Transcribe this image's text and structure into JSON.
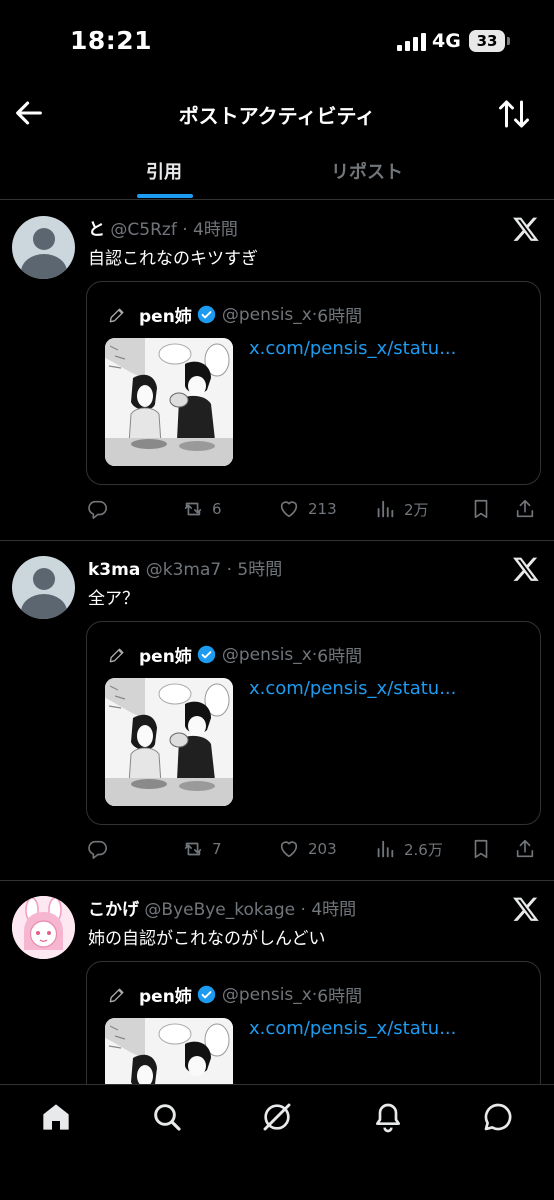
{
  "status_bar": {
    "time": "18:21",
    "network": "4G",
    "battery": "33"
  },
  "header": {
    "title": "ポストアクティビティ",
    "back_icon": "arrow-left-icon",
    "sort_icon": "sort-arrows-icon"
  },
  "tabs": [
    {
      "label": "引用",
      "active": true
    },
    {
      "label": "リポスト",
      "active": false
    }
  ],
  "posts": [
    {
      "name": "と",
      "handle": "@C5Rzf",
      "time": "4時間",
      "text": "自認これなのキツすぎ",
      "quote": {
        "name": "pen姉",
        "handle": "@pensis_x",
        "time": "6時間",
        "link": "x.com/pensis_x/statu..."
      },
      "stats": {
        "retweets": "6",
        "likes": "213",
        "views": "2万"
      }
    },
    {
      "name": "k3ma",
      "handle": "@k3ma7",
      "time": "5時間",
      "text": "全ア？",
      "quote": {
        "name": "pen姉",
        "handle": "@pensis_x",
        "time": "6時間",
        "link": "x.com/pensis_x/statu..."
      },
      "stats": {
        "retweets": "7",
        "likes": "203",
        "views": "2.6万"
      }
    },
    {
      "name": "こかげ",
      "handle": "@ByeBye_kokage",
      "time": "4時間",
      "text": "姉の自認がこれなのがしんどい",
      "quote": {
        "name": "pen姉",
        "handle": "@pensis_x",
        "time": "6時間",
        "link": "x.com/pensis_x/statu..."
      }
    }
  ],
  "bottom_nav": [
    "home-icon",
    "search-icon",
    "grok-icon",
    "notifications-icon",
    "messages-icon"
  ],
  "colors": {
    "accent": "#1d9bf0",
    "background": "#000000",
    "muted": "#71767b",
    "border": "#2f3336"
  }
}
